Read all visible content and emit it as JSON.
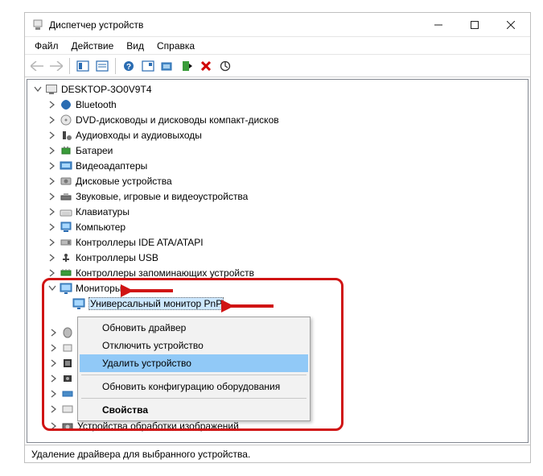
{
  "window": {
    "title": "Диспетчер устройств"
  },
  "menubar": {
    "items": [
      "Файл",
      "Действие",
      "Вид",
      "Справка"
    ]
  },
  "tree": {
    "root": "DESKTOP-3O0V9T4",
    "categories": [
      "Bluetooth",
      "DVD-дисководы и дисководы компакт-дисков",
      "Аудиовходы и аудиовыходы",
      "Батареи",
      "Видеоадаптеры",
      "Дисковые устройства",
      "Звуковые, игровые и видеоустройства",
      "Клавиатуры",
      "Компьютер",
      "Контроллеры IDE ATA/ATAPI",
      "Контроллеры USB",
      "Контроллеры запоминающих устройств"
    ],
    "monitors": {
      "label": "Мониторы",
      "child": "Универсальный монитор PnP"
    },
    "after_categories": [
      "Устройства обработки изображений"
    ]
  },
  "context_menu": {
    "items": [
      "Обновить драйвер",
      "Отключить устройство",
      "Удалить устройство",
      "Обновить конфигурацию оборудования",
      "Свойства"
    ],
    "selected_index": 2
  },
  "statusbar": {
    "text": "Удаление драйвера для выбранного устройства."
  }
}
